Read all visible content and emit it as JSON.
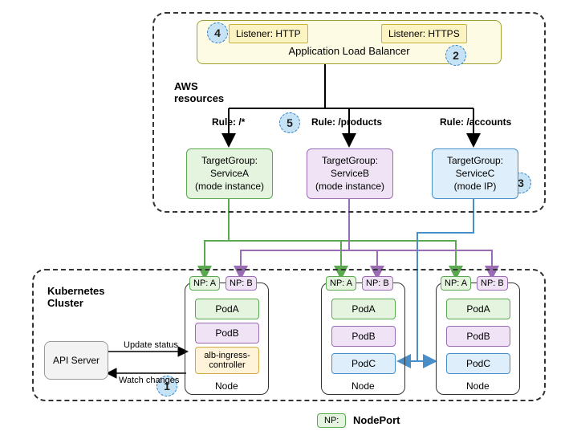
{
  "aws": {
    "section_label": "AWS resources",
    "alb_label": "Application Load Balancer",
    "listener_http": "Listener: HTTP",
    "listener_https": "Listener: HTTPS",
    "rule_a": "Rule: /*",
    "rule_b": "Rule: /products",
    "rule_c": "Rule: /accounts",
    "tg_a_line1": "TargetGroup:",
    "tg_a_line2": "ServiceA",
    "tg_a_line3": "(mode instance)",
    "tg_b_line1": "TargetGroup:",
    "tg_b_line2": "ServiceB",
    "tg_b_line3": "(mode instance)",
    "tg_c_line1": "TargetGroup:",
    "tg_c_line2": "ServiceC",
    "tg_c_line3": "(mode IP)"
  },
  "k8s": {
    "section_label": "Kubernetes Cluster",
    "api_server": "API Server",
    "update_status": "Update status",
    "watch_changes": "Watch changes",
    "alb_controller_l1": "alb-ingress-",
    "alb_controller_l2": "controller",
    "np_a": "NP: A",
    "np_b": "NP: B",
    "pod_a": "PodA",
    "pod_b": "PodB",
    "pod_c": "PodC",
    "node_label": "Node"
  },
  "legend": {
    "np_key": "NP:",
    "np_val": "NodePort"
  },
  "markers": {
    "m1": "1",
    "m2": "2",
    "m3": "3",
    "m4": "4",
    "m5": "5"
  }
}
